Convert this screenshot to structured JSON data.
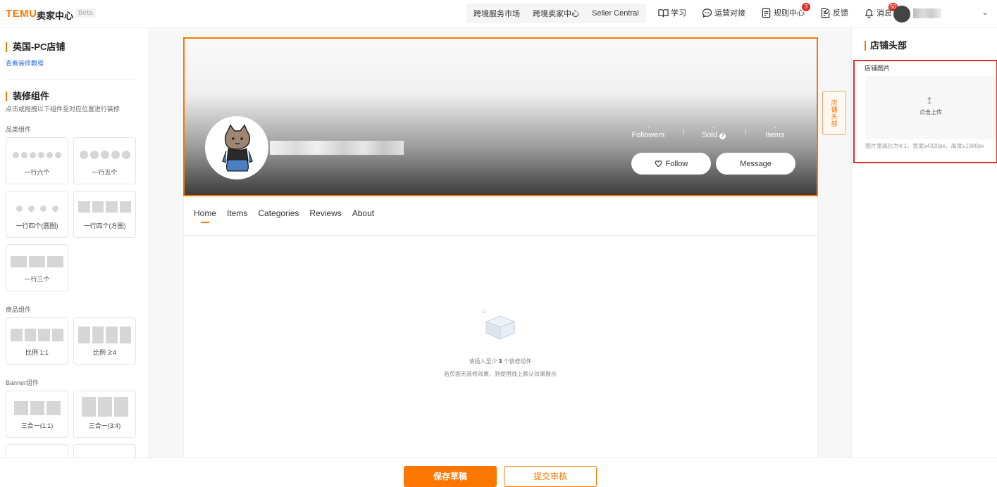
{
  "topbar": {
    "logo": "TEMU",
    "brand": "卖家中心",
    "beta": "Beta",
    "links": [
      "跨境服务市场",
      "跨境卖家中心",
      "Seller Central"
    ],
    "nav": [
      {
        "label": "学习",
        "icon": "book-icon"
      },
      {
        "label": "运营对接",
        "icon": "chat-icon"
      },
      {
        "label": "规则中心",
        "icon": "document-icon",
        "badge": "3"
      },
      {
        "label": "反馈",
        "icon": "feedback-icon"
      },
      {
        "label": "消息",
        "icon": "bell-icon",
        "badge": "50"
      }
    ]
  },
  "left": {
    "store_title": "英国-PC店铺",
    "tutorial_link": "查看装修教程",
    "components_title": "装修组件",
    "hint": "点击或拖拽以下组件至对应位置进行装修",
    "groups": [
      {
        "label": "品类组件",
        "tiles": [
          "一行六个",
          "一行五个",
          "一行四个(圆图)",
          "一行四个(方图)",
          "一行三个"
        ]
      },
      {
        "label": "商品组件",
        "tiles": [
          "比例 1:1",
          "比例 3:4"
        ]
      },
      {
        "label": "Banner组件",
        "tiles": [
          "三合一(1:1)",
          "三合一(3:4)"
        ]
      }
    ]
  },
  "store": {
    "stats": [
      {
        "value": "-",
        "label": "Followers"
      },
      {
        "value": "-",
        "label": "Sold"
      },
      {
        "value": "-",
        "label": "Items"
      }
    ],
    "follow_label": "Follow",
    "message_label": "Message",
    "tabs": [
      "Home",
      "Items",
      "Categories",
      "Reviews",
      "About"
    ],
    "empty_prefix": "请插入至少",
    "empty_count": "3",
    "empty_suffix": "个装修组件",
    "empty_line2": "若页面无装修效果，则使用线上默认效果展示",
    "side_tag": "店铺头部"
  },
  "right": {
    "title": "店铺头部",
    "upload_label": "店铺图片",
    "upload_text": "点击上传",
    "upload_hint": "图片宽高比为4:1，宽度≥4320px，高度≥1080px"
  },
  "footer": {
    "save_label": "保存草稿",
    "submit_label": "提交审核"
  },
  "colors": {
    "accent": "#fb7701",
    "badge": "#e02e24",
    "link": "#2d6ae3"
  }
}
